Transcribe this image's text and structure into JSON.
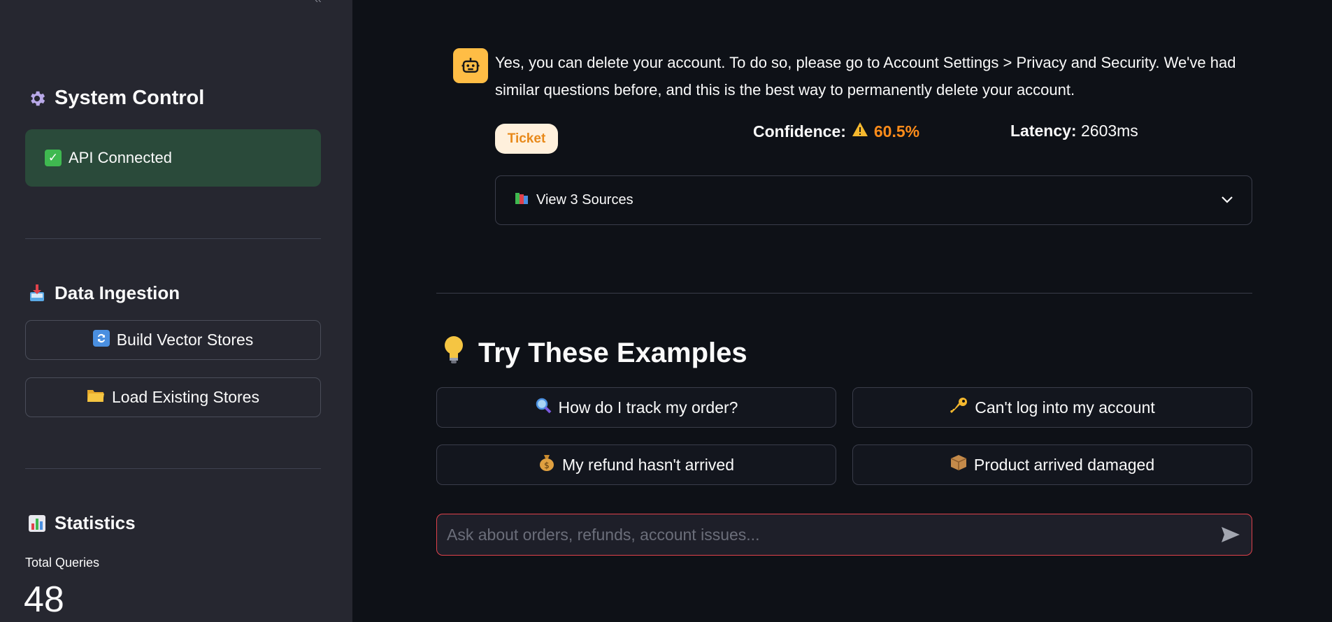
{
  "sidebar": {
    "system_control": {
      "title": "System Control",
      "icon": "gear-icon",
      "status": "API Connected",
      "status_color": "#2a4a3a"
    },
    "data_ingestion": {
      "title": "Data Ingestion",
      "icon": "inbox-tray-icon",
      "build_button": "Build Vector Stores",
      "load_button": "Load Existing Stores"
    },
    "statistics": {
      "title": "Statistics",
      "icon": "bar-chart-icon",
      "total_queries_label": "Total Queries",
      "total_queries_value": "48"
    }
  },
  "chat": {
    "assistant_message": "Yes, you can delete your account. To do so, please go to Account Settings > Privacy and Security. We've had similar questions before, and this is the best way to permanently delete your account.",
    "badge": "Ticket",
    "confidence_label": "Confidence:",
    "confidence_value": "60.5%",
    "latency_label": "Latency:",
    "latency_value": "2603ms",
    "sources_label": "View 3 Sources"
  },
  "examples": {
    "title": "Try These Examples",
    "items": [
      {
        "label": "How do I track my order?",
        "icon": "magnifier-icon"
      },
      {
        "label": "Can't log into my account",
        "icon": "key-icon"
      },
      {
        "label": "My refund hasn't arrived",
        "icon": "money-bag-icon"
      },
      {
        "label": "Product arrived damaged",
        "icon": "package-icon"
      }
    ]
  },
  "input": {
    "placeholder": "Ask about orders, refunds, account issues..."
  },
  "colors": {
    "accent_warning": "#ff8c1a",
    "avatar": "#ffbd45",
    "input_border": "#e0424b"
  }
}
